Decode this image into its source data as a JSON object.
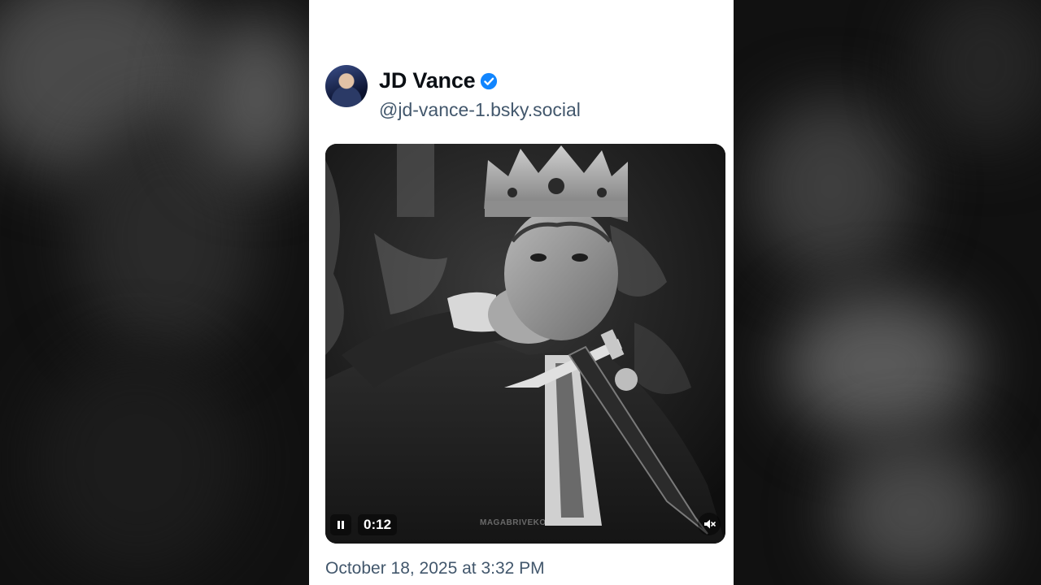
{
  "post": {
    "author": {
      "display_name": "JD Vance",
      "handle": "@jd-vance-1.bsky.social",
      "verified": true
    },
    "media": {
      "type": "video",
      "state": "playing",
      "time": "0:12",
      "watermark": "MAGABRIVEKO"
    },
    "timestamp": "October 18, 2025 at 3:32 PM"
  },
  "icons": {
    "verified": "verified-check-icon",
    "pause": "pause-icon",
    "mute": "speaker-muted-icon"
  },
  "colors": {
    "verified_blue": "#1185fe",
    "secondary_text": "#42576c",
    "primary_text": "#0b0f14"
  }
}
